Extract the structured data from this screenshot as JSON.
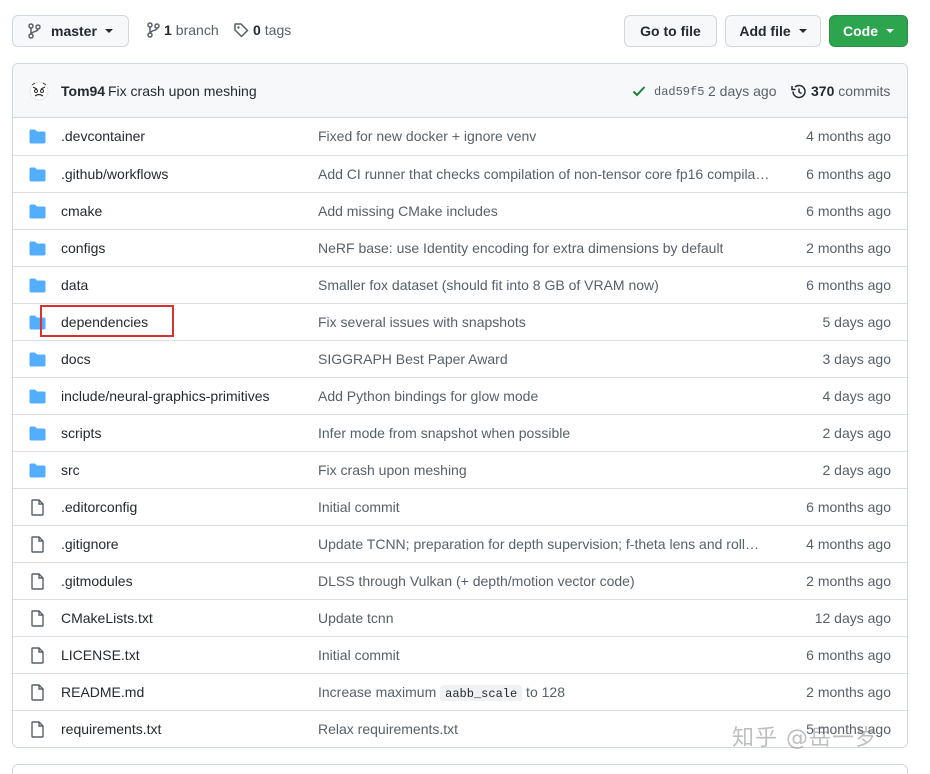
{
  "toolbar": {
    "branch_label": "master",
    "branches_count": "1",
    "branches_label": "branch",
    "tags_count": "0",
    "tags_label": "tags",
    "goto_file_label": "Go to file",
    "add_file_label": "Add file",
    "code_label": "Code",
    "code_color": "#2da44e"
  },
  "commit": {
    "author": "Tom94",
    "message": "Fix crash upon meshing",
    "sha": "dad59f5",
    "time": "2 days ago",
    "count": "370",
    "count_label": "commits"
  },
  "rows": [
    {
      "type": "folder",
      "name": ".devcontainer",
      "message": "Fixed for new docker + ignore venv",
      "time": "4 months ago"
    },
    {
      "type": "folder",
      "name": ".github/workflows",
      "message": "Add CI runner that checks compilation of non-tensor core fp16 compila…",
      "time": "6 months ago"
    },
    {
      "type": "folder",
      "name": "cmake",
      "message": "Add missing CMake includes",
      "time": "6 months ago"
    },
    {
      "type": "folder",
      "name": "configs",
      "message": "NeRF base: use Identity encoding for extra dimensions by default",
      "time": "2 months ago"
    },
    {
      "type": "folder",
      "name": "data",
      "message": "Smaller fox dataset (should fit into 8 GB of VRAM now)",
      "time": "6 months ago"
    },
    {
      "type": "folder",
      "name": "dependencies",
      "message": "Fix several issues with snapshots",
      "time": "5 days ago"
    },
    {
      "type": "folder",
      "name": "docs",
      "message": "SIGGRAPH Best Paper Award",
      "time": "3 days ago"
    },
    {
      "type": "folder",
      "name": "include/neural-graphics-primitives",
      "message": "Add Python bindings for glow mode",
      "time": "4 days ago"
    },
    {
      "type": "folder",
      "name": "scripts",
      "message": "Infer mode from snapshot when possible",
      "time": "2 days ago"
    },
    {
      "type": "folder",
      "name": "src",
      "message": "Fix crash upon meshing",
      "time": "2 days ago"
    },
    {
      "type": "file",
      "name": ".editorconfig",
      "message": "Initial commit",
      "time": "6 months ago"
    },
    {
      "type": "file",
      "name": ".gitignore",
      "message": "Update TCNN; preparation for depth supervision; f-theta lens and roll…",
      "time": "4 months ago"
    },
    {
      "type": "file",
      "name": ".gitmodules",
      "message": "DLSS through Vulkan (+ depth/motion vector code)",
      "time": "2 months ago"
    },
    {
      "type": "file",
      "name": "CMakeLists.txt",
      "message": "Update tcnn",
      "time": "12 days ago"
    },
    {
      "type": "file",
      "name": "LICENSE.txt",
      "message": "Initial commit",
      "time": "6 months ago"
    },
    {
      "type": "file",
      "name": "README.md",
      "message_prefix": "Increase maximum ",
      "message_code": "aabb_scale",
      "message_suffix": " to 128",
      "time": "2 months ago"
    },
    {
      "type": "file",
      "name": "requirements.txt",
      "message": "Relax requirements.txt",
      "time": "5 months ago"
    }
  ],
  "watermark": "知乎 @岳一岁",
  "colors": {
    "folder_icon": "#54aeff",
    "file_icon": "#57606a",
    "check_icon": "#1a7f37",
    "highlight_border": "#d63232"
  }
}
